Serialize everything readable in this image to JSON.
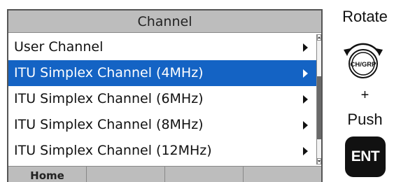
{
  "screen": {
    "title": "Channel",
    "items": [
      {
        "label": "User Channel",
        "selected": false
      },
      {
        "label": "ITU Simplex Channel (4MHz)",
        "selected": true
      },
      {
        "label": "ITU Simplex Channel (6MHz)",
        "selected": false
      },
      {
        "label": "ITU Simplex Channel (8MHz)",
        "selected": false
      },
      {
        "label": "ITU Simplex Channel (12MHz)",
        "selected": false
      }
    ],
    "softkeys": [
      "Home",
      "",
      "",
      ""
    ]
  },
  "instructions": {
    "rotate": "Rotate",
    "knob_label": "CH/GRP",
    "plus": "+",
    "push": "Push",
    "ent_label": "ENT"
  },
  "colors": {
    "selection": "#1463c4",
    "title_bar": "#bdbdbd"
  }
}
